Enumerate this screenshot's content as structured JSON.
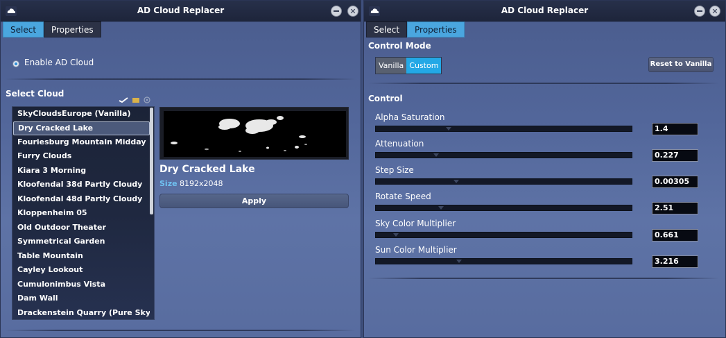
{
  "left_window": {
    "title": "AD Cloud Replacer",
    "tabs": [
      {
        "label": "Select",
        "active": true
      },
      {
        "label": "Properties",
        "active": false
      }
    ],
    "enable_label": "Enable AD Cloud",
    "enable_checked": true,
    "select_cloud_label": "Select Cloud",
    "clouds": [
      "SkyCloudsEurope (Vanilla)",
      "Dry Cracked Lake",
      "Fouriesburg Mountain Midday",
      "Furry Clouds",
      "Kiara 3 Morning",
      "Kloofendal 38d Partly Cloudy",
      "Kloofendal 48d Partly Cloudy",
      "Kloppenheim 05",
      "Old Outdoor Theater",
      "Symmetrical Garden",
      "Table Mountain",
      "Cayley Lookout",
      "Cumulonimbus Vista",
      "Dam Wall",
      "Drackenstein Quarry (Pure Sky)"
    ],
    "selected_cloud_index": 1,
    "preview_name": "Dry Cracked Lake",
    "size_label": "Size",
    "size_value": "8192x2048",
    "apply_label": "Apply"
  },
  "right_window": {
    "title": "AD Cloud Replacer",
    "tabs": [
      {
        "label": "Select",
        "active": false
      },
      {
        "label": "Properties",
        "active": true
      }
    ],
    "control_mode_label": "Control Mode",
    "modes": [
      {
        "label": "Vanilla",
        "active": false
      },
      {
        "label": "Custom",
        "active": true
      }
    ],
    "reset_label": "Reset to Vanilla",
    "control_label": "Control",
    "params": [
      {
        "label": "Alpha Saturation",
        "value": "1.4",
        "slider_fraction": 0.28
      },
      {
        "label": "Attenuation",
        "value": "0.227",
        "slider_fraction": 0.23
      },
      {
        "label": "Step Size",
        "value": "0.00305",
        "slider_fraction": 0.31
      },
      {
        "label": "Rotate Speed",
        "value": "2.51",
        "slider_fraction": 0.25
      },
      {
        "label": "Sky Color Multiplier",
        "value": "0.661",
        "slider_fraction": 0.07
      },
      {
        "label": "Sun Color Multiplier",
        "value": "3.216",
        "slider_fraction": 0.32
      }
    ]
  },
  "colors": {
    "accent": "#4aa6df",
    "mode_active": "#23a8e6",
    "size_label": "#6fc0f0",
    "titlebar": "#1e253b"
  },
  "icons": {
    "app": "cloud-icon",
    "minimize": "minimize-icon",
    "close": "close-icon"
  }
}
